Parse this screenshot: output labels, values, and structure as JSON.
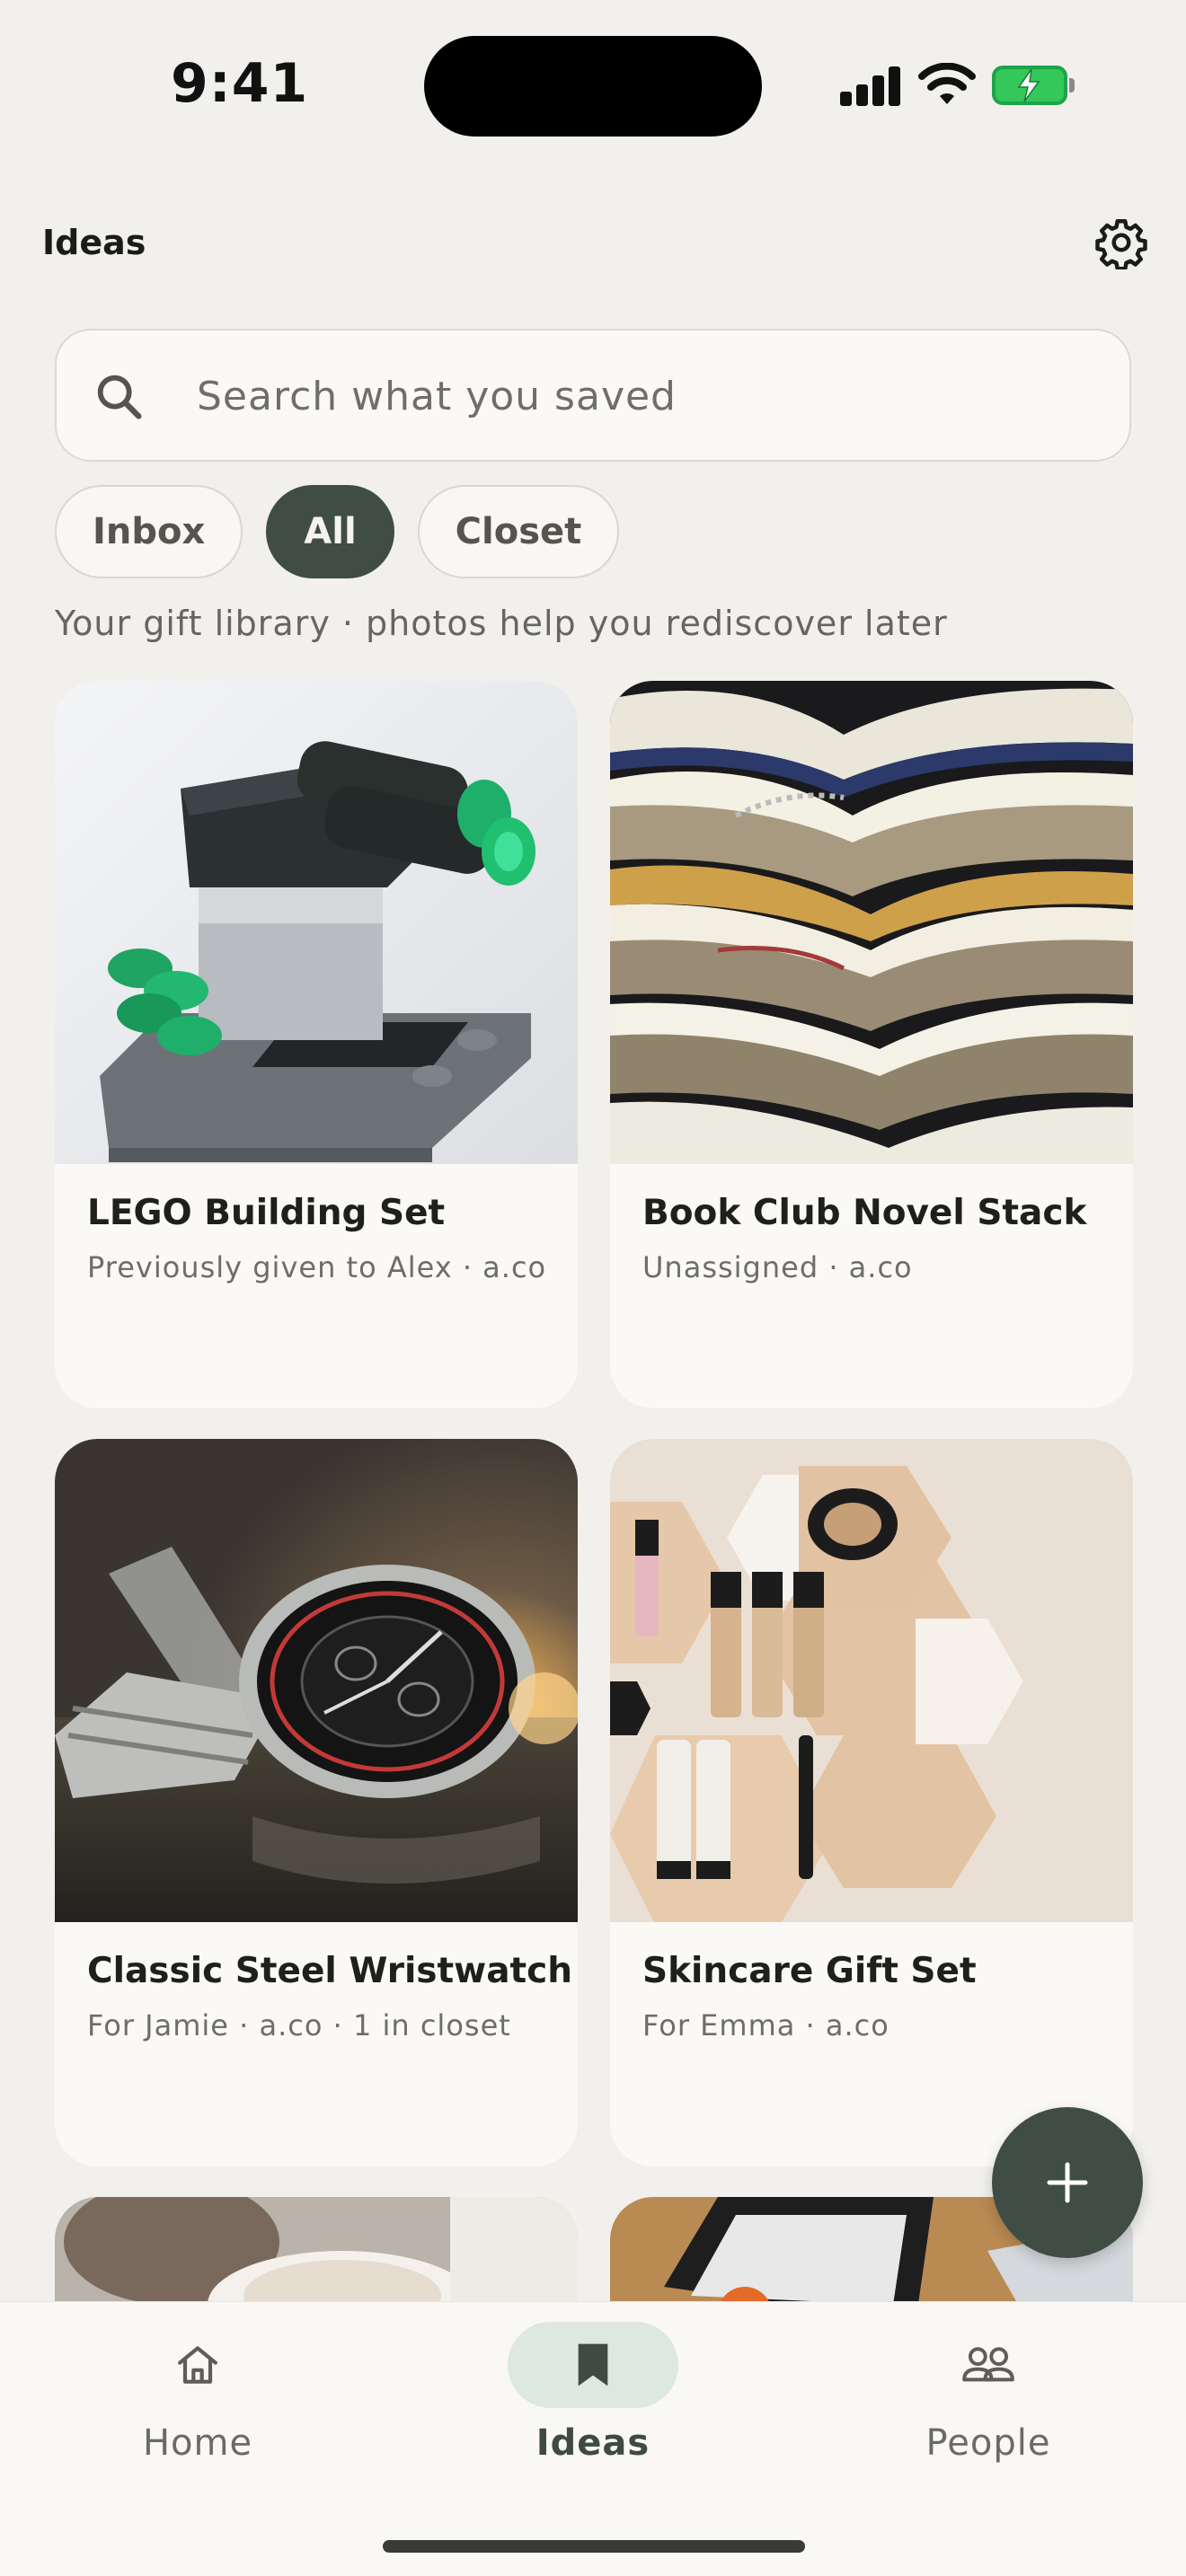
{
  "status_bar": {
    "time": "9:41"
  },
  "header": {
    "title": "Ideas",
    "settings_icon": "gear-icon"
  },
  "search": {
    "placeholder": "Search what you saved",
    "icon": "search-icon"
  },
  "filters": [
    {
      "label": "Inbox",
      "active": false
    },
    {
      "label": "All",
      "active": true
    },
    {
      "label": "Closet",
      "active": false
    }
  ],
  "subtitle": "Your gift library · photos help you rediscover later",
  "items": [
    {
      "title": "LEGO Building Set",
      "meta": "Previously given to Alex · a.co"
    },
    {
      "title": "Book Club Novel Stack",
      "meta": "Unassigned · a.co"
    },
    {
      "title": "Classic Steel Wristwatch",
      "meta": "For Jamie · a.co · 1 in closet"
    },
    {
      "title": "Skincare Gift Set",
      "meta": "For Emma · a.co"
    }
  ],
  "fab": {
    "icon": "plus-icon"
  },
  "nav": [
    {
      "label": "Home",
      "icon": "home-icon",
      "active": false
    },
    {
      "label": "Ideas",
      "icon": "bookmark-icon",
      "active": true
    },
    {
      "label": "People",
      "icon": "people-icon",
      "active": false
    }
  ],
  "colors": {
    "accent": "#3F4D45",
    "background": "#F1F0EC",
    "card": "#FAF9F6",
    "nav_active_pill": "#DCE8E1"
  }
}
